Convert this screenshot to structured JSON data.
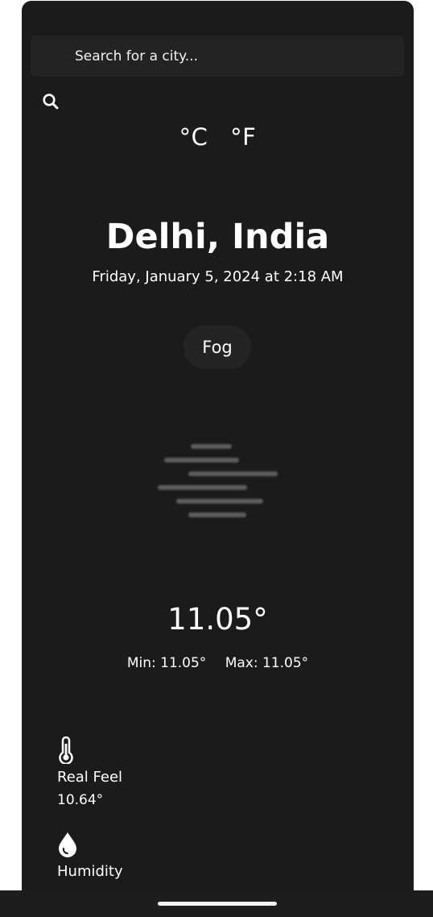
{
  "search": {
    "placeholder": "Search for a city...",
    "icon": "search-icon"
  },
  "units": {
    "celsius": "°C",
    "fahrenheit": "°F"
  },
  "location": {
    "city": "Delhi, India",
    "datetime": "Friday, January 5, 2024 at 2:18 AM"
  },
  "weather": {
    "condition": "Fog",
    "condition_icon": "fog-icon",
    "temperature": "11.05°",
    "min": "Min: 11.05°",
    "max": "Max: 11.05°"
  },
  "details": [
    {
      "icon": "thermometer-icon",
      "label": "Real Feel",
      "value": "10.64°"
    },
    {
      "icon": "droplet-icon",
      "label": "Humidity",
      "value": ""
    }
  ],
  "colors": {
    "background": "#1b1b1b",
    "surface": "#232323",
    "text": "#ffffff",
    "fog_lines": "#5a5a5a"
  }
}
